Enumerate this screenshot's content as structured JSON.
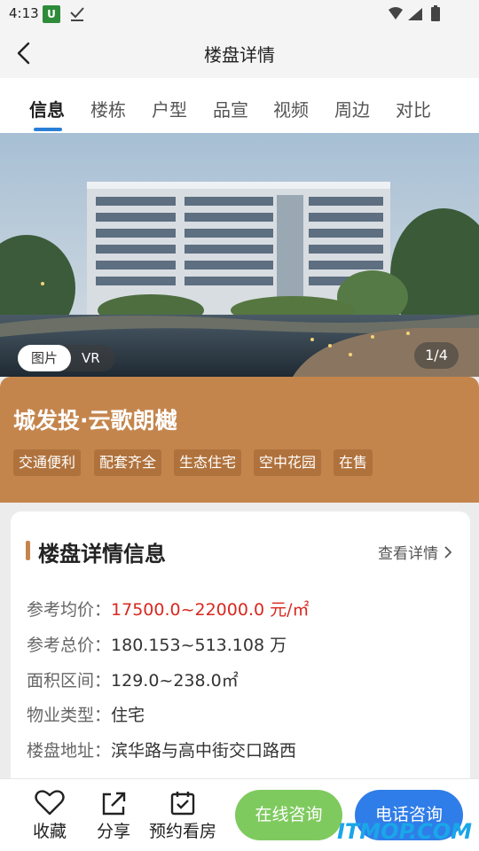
{
  "status": {
    "time": "4:13",
    "app_icon_letter": "U"
  },
  "nav": {
    "title": "楼盘详情"
  },
  "tabs": [
    {
      "label": "信息"
    },
    {
      "label": "楼栋"
    },
    {
      "label": "户型"
    },
    {
      "label": "品宣"
    },
    {
      "label": "视频"
    },
    {
      "label": "周边"
    },
    {
      "label": "对比"
    }
  ],
  "hero": {
    "photo_label": "图片",
    "vr_label": "VR",
    "counter": "1/4"
  },
  "project": {
    "name": "城发投·云歌朗樾",
    "tags": [
      "交通便利",
      "配套齐全",
      "生态住宅",
      "空中花园",
      "在售"
    ]
  },
  "details": {
    "title": "楼盘详情信息",
    "more_label": "查看详情",
    "rows": [
      {
        "label": "参考均价：",
        "value": "17500.0~22000.0 元/㎡"
      },
      {
        "label": "参考总价：",
        "value": "180.153~513.108 万"
      },
      {
        "label": "面积区间：",
        "value": "129.0~238.0㎡"
      },
      {
        "label": "物业类型：",
        "value": "住宅"
      },
      {
        "label": "楼盘地址：",
        "value": "滨华路与高中街交口路西"
      }
    ]
  },
  "bottom": {
    "favorite": "收藏",
    "share": "分享",
    "appointment": "预约看房",
    "consult": "在线咨询",
    "call": "电话咨询"
  },
  "watermark": "ITMOP.COM",
  "colors": {
    "accent": "#c4854d",
    "tab_active": "#2a7fd6",
    "price": "#d8281f",
    "consult": "#7fca5f",
    "call": "#2f7de8"
  }
}
